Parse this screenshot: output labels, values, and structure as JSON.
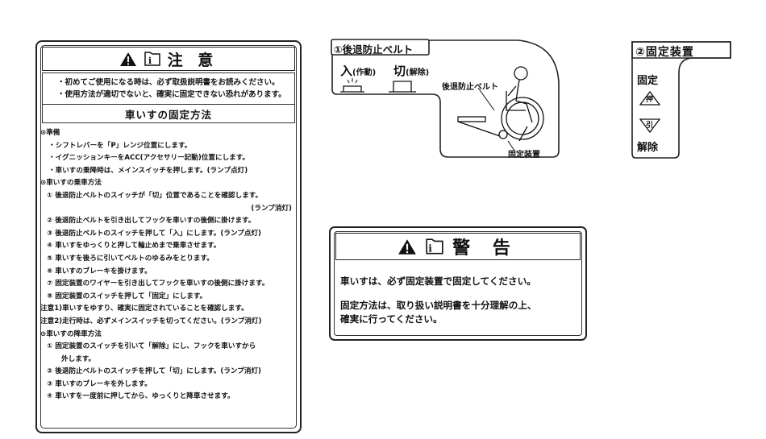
{
  "caution": {
    "title": "注 意",
    "intro": [
      "・初めてご使用になる時は、必ず取扱説明書をお読みください。",
      "・使用方法が適切でないと、確実に固定できない恐れがあります。"
    ],
    "method_title": "車いすの固定方法",
    "lines": [
      {
        "text": "⊙準備",
        "cls": ""
      },
      {
        "text": "・シフトレバーを「P」レンジ位置にします。",
        "cls": "ind1"
      },
      {
        "text": "・イグニッションキーをACC(アクセサリー記動)位置にします。",
        "cls": "ind1"
      },
      {
        "text": "・車いすの乗降時は、メインスイッチを押します。(ランプ点灯)",
        "cls": "ind1"
      },
      {
        "text": "⊙車いすの乗車方法",
        "cls": ""
      },
      {
        "text": "① 後退防止ベルトのスイッチが「切」位置であることを確認します。",
        "cls": "ind2"
      },
      {
        "text": "(ランプ消灯)",
        "cls": "right"
      },
      {
        "text": "② 後退防止ベルトを引き出してフックを車いすの後側に掛けます。",
        "cls": "ind2"
      },
      {
        "text": "③ 後退防止ベルトのスイッチを押して「入」にします。(ランプ点灯)",
        "cls": "ind2"
      },
      {
        "text": "④ 車いすをゆっくりと押して輪止めまで乗車させます。",
        "cls": "ind2"
      },
      {
        "text": "⑤ 車いすを後ろに引いてベルトのゆるみをとります。",
        "cls": "ind2"
      },
      {
        "text": "⑥ 車いすのブレーキを掛けます。",
        "cls": "ind2"
      },
      {
        "text": "⑦ 固定装置のワイヤーを引き出してフックを車いすの後側に掛けます。",
        "cls": "ind2"
      },
      {
        "text": "⑧ 固定装置のスイッチを押して「固定」にします。",
        "cls": "ind2"
      },
      {
        "text": "注意1)車いすをゆすり、確実に固定されていることを確認します。",
        "cls": ""
      },
      {
        "text": "注意2)走行時は、必ずメインスイッチを切ってください。(ランプ消灯)",
        "cls": ""
      },
      {
        "text": "⊙車いすの降車方法",
        "cls": ""
      },
      {
        "text": "① 固定装置のスイッチを引いて「解除」にし、フックを車いすから",
        "cls": "ind2"
      },
      {
        "text": "外します。",
        "cls": "ind3"
      },
      {
        "text": "② 後退防止ベルトのスイッチを押して「切」にします。(ランプ消灯)",
        "cls": "ind2"
      },
      {
        "text": "③ 車いすのブレーキを外します。",
        "cls": "ind2"
      },
      {
        "text": "④ 車いすを一度前に押してから、ゆっくりと降車させます。",
        "cls": "ind2"
      }
    ]
  },
  "belt_label": {
    "title": "①後退防止ベルト",
    "on": "入",
    "on_sub": "(作動)",
    "off": "切",
    "off_sub": "(解除)",
    "belt_callout": "後退防止ベルト",
    "fix_callout": "固定装置"
  },
  "fix_label": {
    "title": "②固定装置",
    "fix": "固定",
    "push": "押",
    "pull": "引",
    "release": "解除"
  },
  "warning": {
    "title": "警 告",
    "line1": "車いすは、必ず固定装置で固定してください。",
    "line2a": "固定方法は、取り扱い説明書を十分理解の上、",
    "line2b": "確実に行ってください。"
  }
}
